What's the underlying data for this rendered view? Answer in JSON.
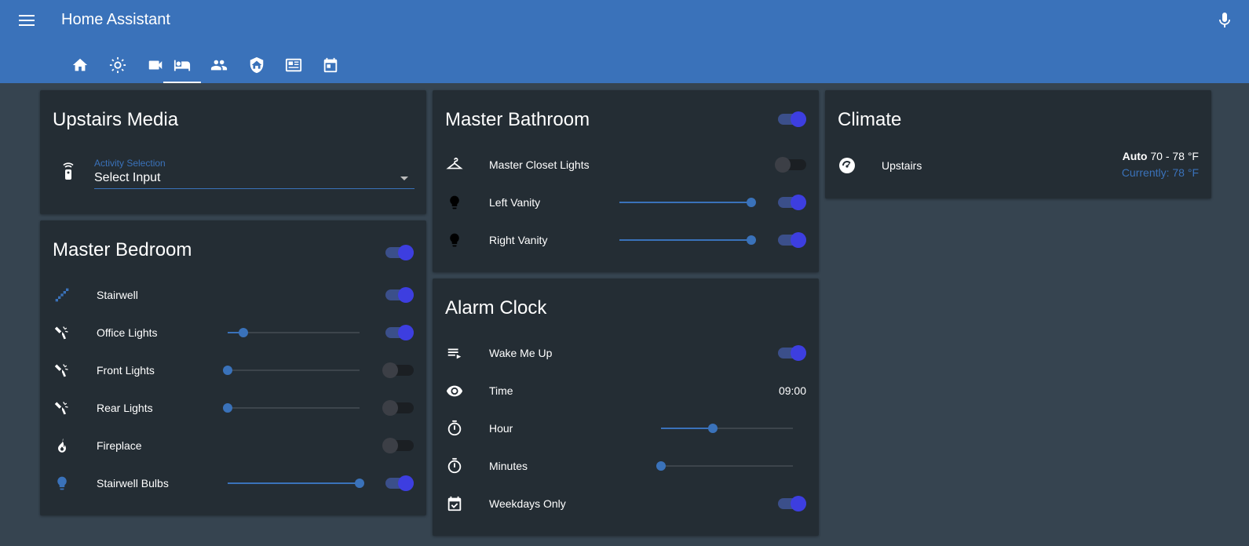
{
  "app": {
    "title": "Home Assistant"
  },
  "tabs": [
    {
      "icon": "home-icon",
      "active": false
    },
    {
      "icon": "brightness-icon",
      "active": false
    },
    {
      "icon": "video-camera-icon",
      "active": false
    },
    {
      "icon": "bed-icon",
      "active": true
    },
    {
      "icon": "people-icon",
      "active": false
    },
    {
      "icon": "shield-home-icon",
      "active": false
    },
    {
      "icon": "newspaper-icon",
      "active": false
    },
    {
      "icon": "calendar-icon",
      "active": false
    }
  ],
  "upstairs_media": {
    "title": "Upstairs Media",
    "select_label": "Activity Selection",
    "select_value": "Select Input"
  },
  "master_bedroom": {
    "title": "Master Bedroom",
    "rows": [
      {
        "label": "Stairwell",
        "icon": "stairs-icon",
        "toggle": true,
        "slider": null
      },
      {
        "label": "Office Lights",
        "icon": "spotlight-icon",
        "toggle": true,
        "slider": 0.12
      },
      {
        "label": "Front Lights",
        "icon": "spotlight-icon",
        "toggle": false,
        "slider": 0.0
      },
      {
        "label": "Rear Lights",
        "icon": "spotlight-icon",
        "toggle": false,
        "slider": 0.0
      },
      {
        "label": "Fireplace",
        "icon": "fire-icon",
        "toggle": false,
        "slider": null
      },
      {
        "label": "Stairwell Bulbs",
        "icon": "lightbulb-icon",
        "toggle": true,
        "slider": 1.0
      }
    ]
  },
  "master_bathroom": {
    "title": "Master Bathroom",
    "rows": [
      {
        "label": "Master Closet Lights",
        "icon": "hanger-icon",
        "toggle": false,
        "slider": null
      },
      {
        "label": "Left Vanity",
        "icon": "lightbulb-icon",
        "toggle": true,
        "slider": 1.0
      },
      {
        "label": "Right Vanity",
        "icon": "lightbulb-icon",
        "toggle": true,
        "slider": 1.0
      }
    ]
  },
  "alarm_clock": {
    "title": "Alarm Clock",
    "rows": [
      {
        "label": "Wake Me Up",
        "icon": "playlist-icon",
        "toggle": true
      },
      {
        "label": "Time",
        "icon": "eye-icon",
        "value": "09:00"
      },
      {
        "label": "Hour",
        "icon": "timer-icon",
        "slider": 0.39
      },
      {
        "label": "Minutes",
        "icon": "timer-icon",
        "slider": 0.0
      },
      {
        "label": "Weekdays Only",
        "icon": "calendar-check-icon",
        "toggle": true
      }
    ]
  },
  "climate": {
    "title": "Climate",
    "entity": "Upstairs",
    "mode": "Auto",
    "range": "70 - 78 °F",
    "current": "Currently: 78 °F"
  },
  "colors": {
    "header": "#3a72ba",
    "accent": "#3a72ba",
    "toggle_on": "#3d3ee0",
    "card": "#242d34",
    "background": "#364450"
  }
}
